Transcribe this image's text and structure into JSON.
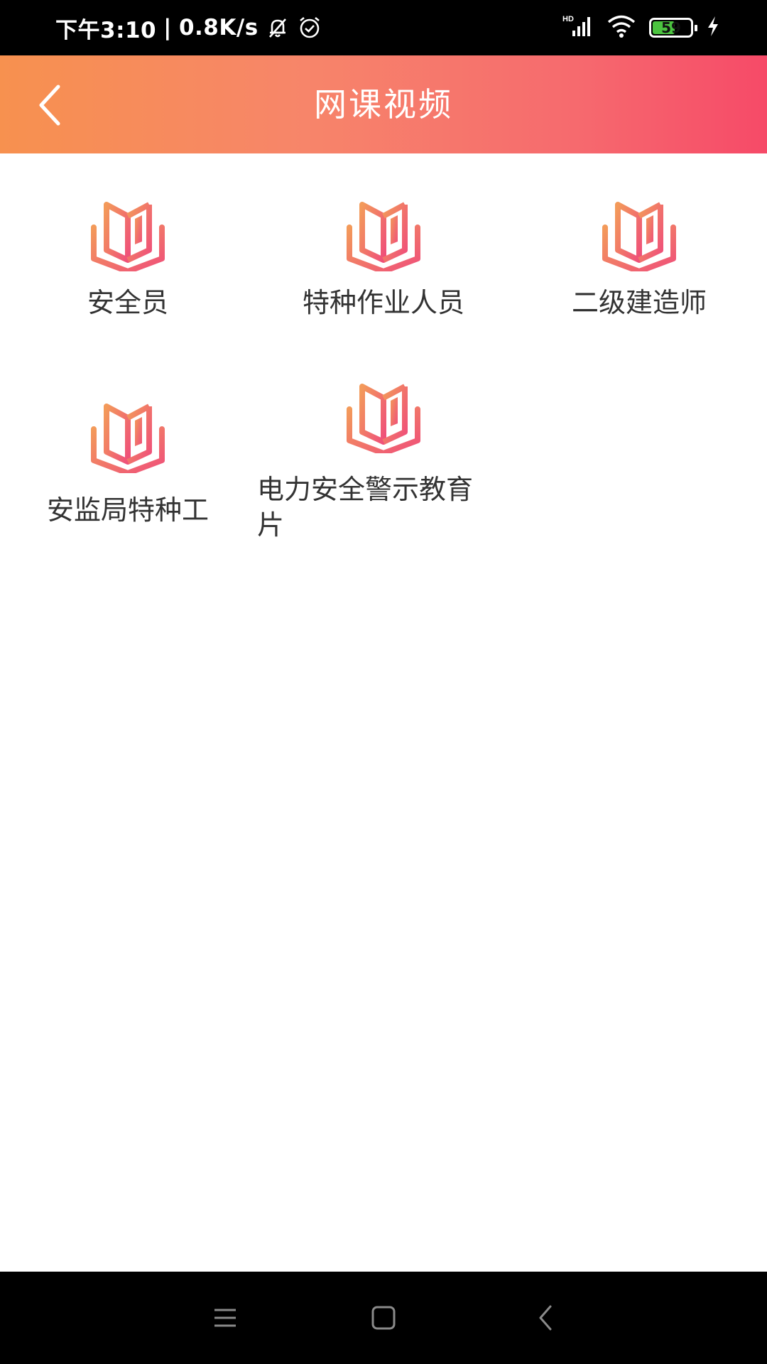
{
  "status_bar": {
    "time": "下午3:10",
    "net_speed": "0.8K/s",
    "separator": "|",
    "network_label": "HD",
    "battery_level": "59",
    "battery_fraction": 0.59
  },
  "header": {
    "title": "网课视频"
  },
  "courses": [
    {
      "label": "安全员",
      "icon": "open-book-icon"
    },
    {
      "label": "特种作业人员",
      "icon": "open-book-icon"
    },
    {
      "label": "二级建造师",
      "icon": "open-book-icon"
    },
    {
      "label": "安监局特种工",
      "icon": "open-book-icon"
    },
    {
      "label": "电力安全警示教育片",
      "icon": "open-book-icon"
    }
  ],
  "colors": {
    "header_gradient_start": "#f7914f",
    "header_gradient_end": "#f64a68",
    "icon_gradient_start": "#f39a5a",
    "icon_gradient_end": "#ef4f7a",
    "label_text": "#333333"
  },
  "nav_bar": {
    "icons": [
      "menu-icon",
      "home-icon",
      "back-icon"
    ]
  }
}
